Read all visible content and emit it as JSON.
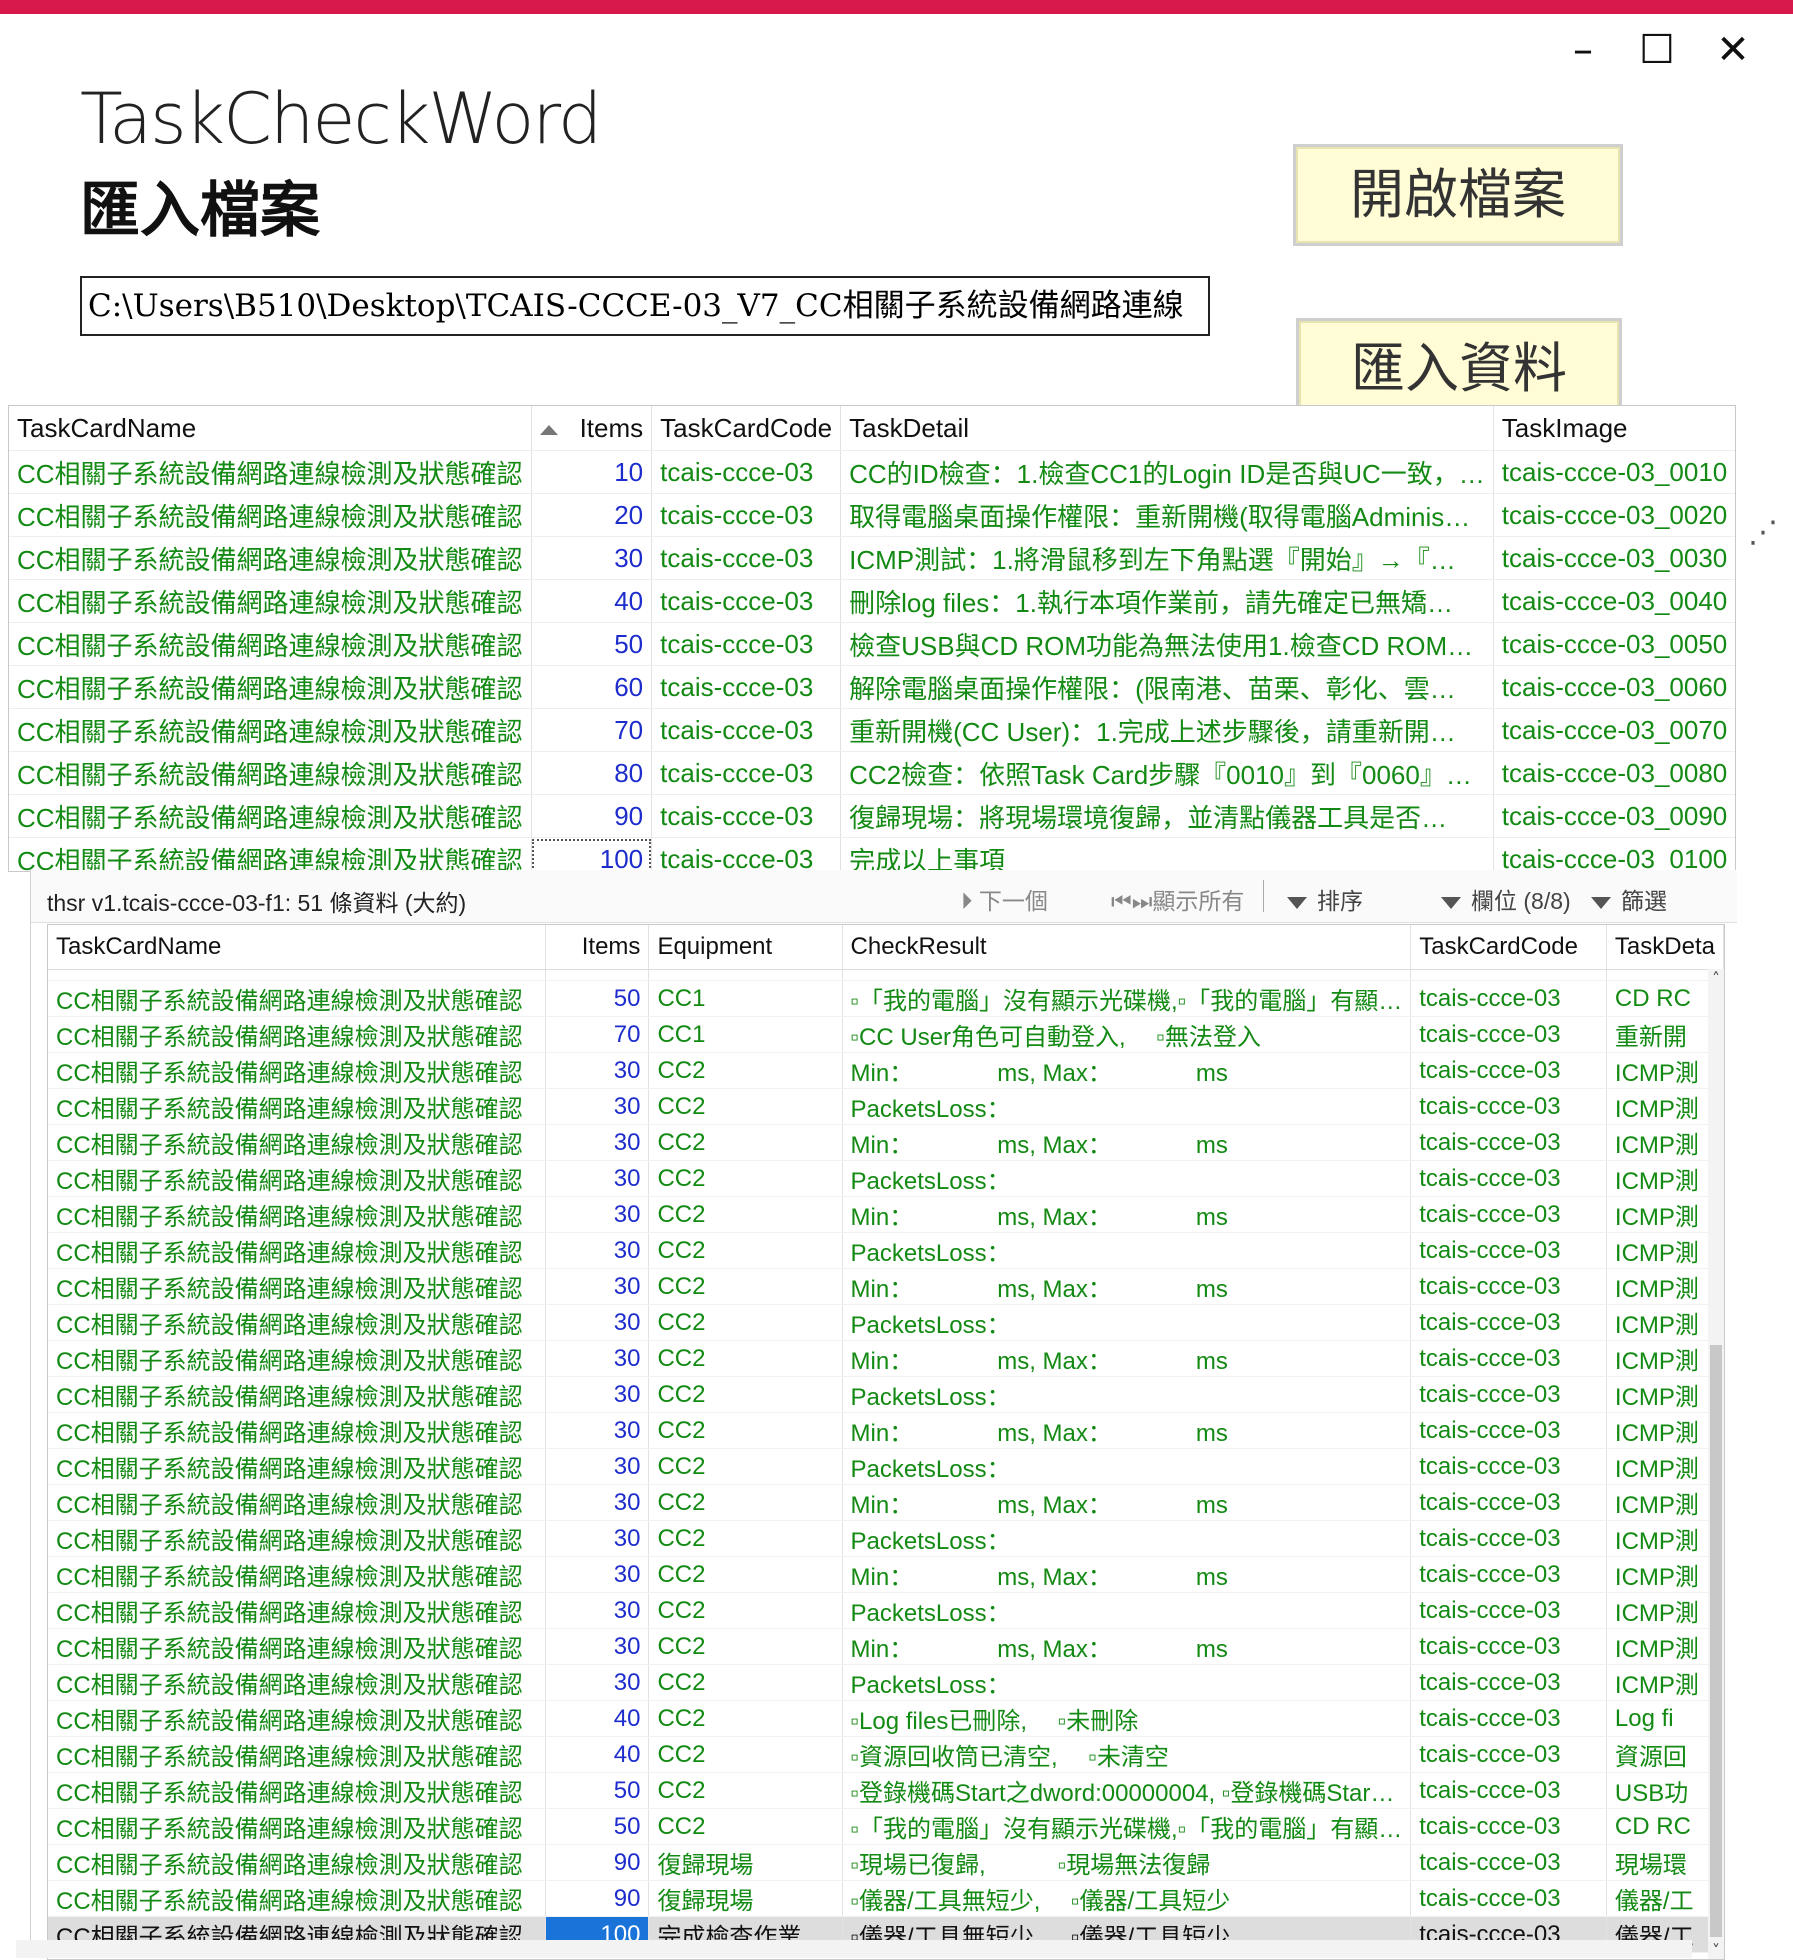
{
  "window": {
    "minimize": "–",
    "maximize": "☐",
    "close": "✕"
  },
  "app": {
    "title": "TaskCheckWord",
    "subtitle": "匯入檔案"
  },
  "file_path": "C:\\Users\\B510\\Desktop\\TCAIS-CCCE-03_V7_CC相關子系統設備網路連線",
  "buttons": {
    "open_file": "開啟檔案",
    "import_data": "匯入資料"
  },
  "grid1": {
    "columns": [
      "TaskCardName",
      "Items",
      "TaskCardCode",
      "TaskDetail",
      "TaskImage"
    ],
    "rows": [
      {
        "name": "CC相關子系統設備網路連線檢測及狀態確認",
        "items": "10",
        "code": "tcais-ccce-03",
        "detail": "CC的ID檢查：1.檢查CC1的Login ID是否與UC一致，…",
        "image": "tcais-ccce-03_0010"
      },
      {
        "name": "CC相關子系統設備網路連線檢測及狀態確認",
        "items": "20",
        "code": "tcais-ccce-03",
        "detail": "取得電腦桌面操作權限：重新開機(取得電腦Adminis…",
        "image": "tcais-ccce-03_0020"
      },
      {
        "name": "CC相關子系統設備網路連線檢測及狀態確認",
        "items": "30",
        "code": "tcais-ccce-03",
        "detail": "ICMP測試：1.將滑鼠移到左下角點選『開始』→『…",
        "image": "tcais-ccce-03_0030"
      },
      {
        "name": "CC相關子系統設備網路連線檢測及狀態確認",
        "items": "40",
        "code": "tcais-ccce-03",
        "detail": "刪除log files：1.執行本項作業前，請先確定已無矯…",
        "image": "tcais-ccce-03_0040"
      },
      {
        "name": "CC相關子系統設備網路連線檢測及狀態確認",
        "items": "50",
        "code": "tcais-ccce-03",
        "detail": "檢查USB與CD ROM功能為無法使用1.檢查CD ROM…",
        "image": "tcais-ccce-03_0050"
      },
      {
        "name": "CC相關子系統設備網路連線檢測及狀態確認",
        "items": "60",
        "code": "tcais-ccce-03",
        "detail": "解除電腦桌面操作權限：(限南港、苗栗、彰化、雲…",
        "image": "tcais-ccce-03_0060"
      },
      {
        "name": "CC相關子系統設備網路連線檢測及狀態確認",
        "items": "70",
        "code": "tcais-ccce-03",
        "detail": "重新開機(CC User)：1.完成上述步驟後，請重新開…",
        "image": "tcais-ccce-03_0070"
      },
      {
        "name": "CC相關子系統設備網路連線檢測及狀態確認",
        "items": "80",
        "code": "tcais-ccce-03",
        "detail": "CC2檢查：依照Task Card步驟『0010』到『0060』…",
        "image": "tcais-ccce-03_0080"
      },
      {
        "name": "CC相關子系統設備網路連線檢測及狀態確認",
        "items": "90",
        "code": "tcais-ccce-03",
        "detail": "復歸現場：將現場環境復歸，並清點儀器工具是否…",
        "image": "tcais-ccce-03_0090"
      },
      {
        "name": "CC相關子系統設備網路連線檢測及狀態確認",
        "items": "100",
        "code": "tcais-ccce-03",
        "detail": "完成以上事項",
        "image": "tcais-ccce-03_0100"
      }
    ]
  },
  "toolbar": {
    "status": "thsr v1.tcais-ccce-03-f1: 51 條資料 (大約)",
    "next": "下一個",
    "show_all": "顯示所有",
    "sort": "排序",
    "fields": "欄位 (8/8)",
    "filter": "篩選"
  },
  "grid2": {
    "columns": [
      "TaskCardName",
      "Items",
      "Equipment",
      "CheckResult",
      "TaskCardCode",
      "TaskDeta"
    ],
    "rows": [
      {
        "name": "CC相關子系統設備網路連線檢測及狀態確認",
        "items": "50",
        "equip": "CC1",
        "result": "▫「我的電腦」沒有顯示光碟機,▫「我的電腦」有顯…",
        "code": "tcais-ccce-03",
        "detail": "CD RC"
      },
      {
        "name": "CC相關子系統設備網路連線檢測及狀態確認",
        "items": "70",
        "equip": "CC1",
        "result": "▫CC User角色可自動登入,　 ▫無法登入",
        "code": "tcais-ccce-03",
        "detail": "重新開"
      },
      {
        "name": "CC相關子系統設備網路連線檢測及狀態確認",
        "items": "30",
        "equip": "CC2",
        "result": "Min：　　　　ms,  Max：　　　　ms",
        "code": "tcais-ccce-03",
        "detail": "ICMP測"
      },
      {
        "name": "CC相關子系統設備網路連線檢測及狀態確認",
        "items": "30",
        "equip": "CC2",
        "result": "PacketsLoss：",
        "code": "tcais-ccce-03",
        "detail": "ICMP測"
      },
      {
        "name": "CC相關子系統設備網路連線檢測及狀態確認",
        "items": "30",
        "equip": "CC2",
        "result": "Min：　　　　ms,  Max：　　　　ms",
        "code": "tcais-ccce-03",
        "detail": "ICMP測"
      },
      {
        "name": "CC相關子系統設備網路連線檢測及狀態確認",
        "items": "30",
        "equip": "CC2",
        "result": "PacketsLoss：",
        "code": "tcais-ccce-03",
        "detail": "ICMP測"
      },
      {
        "name": "CC相關子系統設備網路連線檢測及狀態確認",
        "items": "30",
        "equip": "CC2",
        "result": "Min：　　　　ms,  Max：　　　　ms",
        "code": "tcais-ccce-03",
        "detail": "ICMP測"
      },
      {
        "name": "CC相關子系統設備網路連線檢測及狀態確認",
        "items": "30",
        "equip": "CC2",
        "result": "PacketsLoss：",
        "code": "tcais-ccce-03",
        "detail": "ICMP測"
      },
      {
        "name": "CC相關子系統設備網路連線檢測及狀態確認",
        "items": "30",
        "equip": "CC2",
        "result": "Min：　　　　ms,  Max：　　　　ms",
        "code": "tcais-ccce-03",
        "detail": "ICMP測"
      },
      {
        "name": "CC相關子系統設備網路連線檢測及狀態確認",
        "items": "30",
        "equip": "CC2",
        "result": "PacketsLoss：",
        "code": "tcais-ccce-03",
        "detail": "ICMP測"
      },
      {
        "name": "CC相關子系統設備網路連線檢測及狀態確認",
        "items": "30",
        "equip": "CC2",
        "result": "Min：　　　　ms,  Max：　　　　ms",
        "code": "tcais-ccce-03",
        "detail": "ICMP測"
      },
      {
        "name": "CC相關子系統設備網路連線檢測及狀態確認",
        "items": "30",
        "equip": "CC2",
        "result": "PacketsLoss：",
        "code": "tcais-ccce-03",
        "detail": "ICMP測"
      },
      {
        "name": "CC相關子系統設備網路連線檢測及狀態確認",
        "items": "30",
        "equip": "CC2",
        "result": "Min：　　　　ms,  Max：　　　　ms",
        "code": "tcais-ccce-03",
        "detail": "ICMP測"
      },
      {
        "name": "CC相關子系統設備網路連線檢測及狀態確認",
        "items": "30",
        "equip": "CC2",
        "result": "PacketsLoss：",
        "code": "tcais-ccce-03",
        "detail": "ICMP測"
      },
      {
        "name": "CC相關子系統設備網路連線檢測及狀態確認",
        "items": "30",
        "equip": "CC2",
        "result": "Min：　　　　ms,  Max：　　　　ms",
        "code": "tcais-ccce-03",
        "detail": "ICMP測"
      },
      {
        "name": "CC相關子系統設備網路連線檢測及狀態確認",
        "items": "30",
        "equip": "CC2",
        "result": "PacketsLoss：",
        "code": "tcais-ccce-03",
        "detail": "ICMP測"
      },
      {
        "name": "CC相關子系統設備網路連線檢測及狀態確認",
        "items": "30",
        "equip": "CC2",
        "result": "Min：　　　　ms,  Max：　　　　ms",
        "code": "tcais-ccce-03",
        "detail": "ICMP測"
      },
      {
        "name": "CC相關子系統設備網路連線檢測及狀態確認",
        "items": "30",
        "equip": "CC2",
        "result": "PacketsLoss：",
        "code": "tcais-ccce-03",
        "detail": "ICMP測"
      },
      {
        "name": "CC相關子系統設備網路連線檢測及狀態確認",
        "items": "30",
        "equip": "CC2",
        "result": "Min：　　　　ms,  Max：　　　　ms",
        "code": "tcais-ccce-03",
        "detail": "ICMP測"
      },
      {
        "name": "CC相關子系統設備網路連線檢測及狀態確認",
        "items": "30",
        "equip": "CC2",
        "result": "PacketsLoss：",
        "code": "tcais-ccce-03",
        "detail": "ICMP測"
      },
      {
        "name": "CC相關子系統設備網路連線檢測及狀態確認",
        "items": "40",
        "equip": "CC2",
        "result": "▫Log files已刪除,　 ▫未刪除",
        "code": "tcais-ccce-03",
        "detail": "Log fi"
      },
      {
        "name": "CC相關子系統設備網路連線檢測及狀態確認",
        "items": "40",
        "equip": "CC2",
        "result": "▫資源回收筒已清空,　 ▫未清空",
        "code": "tcais-ccce-03",
        "detail": "資源回"
      },
      {
        "name": "CC相關子系統設備網路連線檢測及狀態確認",
        "items": "50",
        "equip": "CC2",
        "result": "▫登錄機碼Start之dword:00000004, ▫登錄機碼Star…",
        "code": "tcais-ccce-03",
        "detail": "USB功"
      },
      {
        "name": "CC相關子系統設備網路連線檢測及狀態確認",
        "items": "50",
        "equip": "CC2",
        "result": "▫「我的電腦」沒有顯示光碟機,▫「我的電腦」有顯…",
        "code": "tcais-ccce-03",
        "detail": "CD RC"
      },
      {
        "name": "CC相關子系統設備網路連線檢測及狀態確認",
        "items": "90",
        "equip": "復歸現場",
        "result": "▫現場已復歸,　　　▫現場無法復歸",
        "code": "tcais-ccce-03",
        "detail": "現場環"
      },
      {
        "name": "CC相關子系統設備網路連線檢測及狀態確認",
        "items": "90",
        "equip": "復歸現場",
        "result": "▫儀器/工具無短少,　 ▫儀器/工具短少",
        "code": "tcais-ccce-03",
        "detail": "儀器/工"
      },
      {
        "name": "CC相關子系統設備網路連線檢測及狀態確認",
        "items": "100",
        "equip": "完成檢查作業",
        "result": "▫儀器/工具無短少,　 ▫儀器/工具短少",
        "code": "tcais-ccce-03",
        "detail": "儀器/工"
      }
    ]
  }
}
